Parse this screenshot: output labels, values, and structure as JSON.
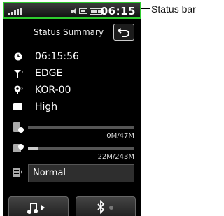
{
  "annotation": {
    "label": "Status bar"
  },
  "statusbar": {
    "time": "06:15"
  },
  "header": {
    "title": "Status Summary"
  },
  "rows": [
    {
      "icon": "clock-icon",
      "value": "06:15:56"
    },
    {
      "icon": "antenna-icon",
      "value": "EDGE"
    },
    {
      "icon": "network-icon",
      "value": "KOR-00"
    },
    {
      "icon": "battery-icon",
      "value": "High"
    }
  ],
  "memory": [
    {
      "icon": "phone-memory-icon",
      "label": "0M/47M",
      "level": 0.0
    },
    {
      "icon": "external-memory-icon",
      "label": "22M/243M",
      "level": 0.09
    }
  ],
  "profile": {
    "icon": "profile-icon",
    "value": "Normal"
  },
  "bottom_buttons": [
    {
      "icon": "music-play-icon"
    },
    {
      "icon": "bluetooth-icon"
    }
  ],
  "colors": {
    "statusbar_border": "#2ecc2e",
    "background": "#000000",
    "text": "#ffffff"
  }
}
